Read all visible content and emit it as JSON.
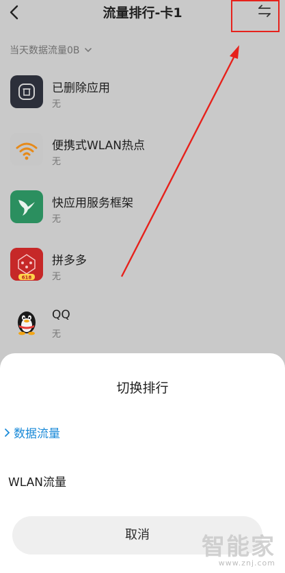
{
  "header": {
    "title": "流量排行-卡1"
  },
  "summary": {
    "text": "当天数据流量0B"
  },
  "apps": [
    {
      "name": "已删除应用",
      "usage": "无",
      "icon": "deleted-apps-icon"
    },
    {
      "name": "便携式WLAN热点",
      "usage": "无",
      "icon": "wifi-hotspot-icon"
    },
    {
      "name": "快应用服务框架",
      "usage": "无",
      "icon": "quick-app-bird-icon"
    },
    {
      "name": "拼多多",
      "usage": "无",
      "icon": "pinduoduo-icon",
      "badge": "618"
    },
    {
      "name": "QQ",
      "usage": "无",
      "icon": "qq-penguin-icon"
    }
  ],
  "sheet": {
    "title": "切换排行",
    "options": [
      {
        "label": "数据流量",
        "selected": true
      },
      {
        "label": "WLAN流量",
        "selected": false
      }
    ],
    "cancel_label": "取消"
  },
  "watermark": {
    "main": "智能家",
    "sub": "www.znj.com"
  },
  "colors": {
    "accent": "#1a8ad8",
    "annotation_red": "#e6211b"
  }
}
